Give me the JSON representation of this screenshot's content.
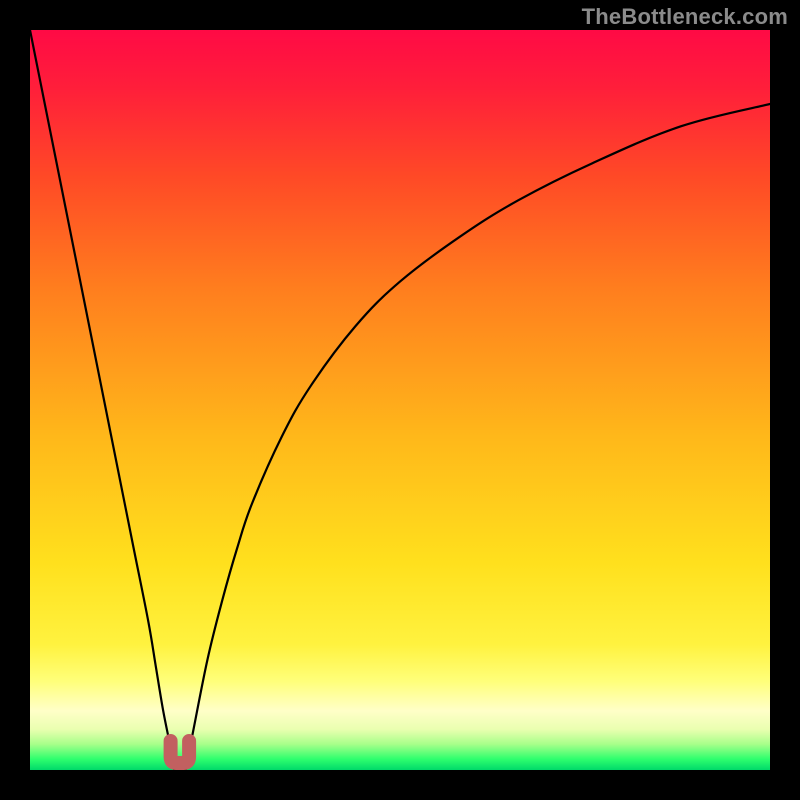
{
  "watermark": "TheBottleneck.com",
  "colors": {
    "frame": "#000000",
    "gradient_stops": [
      {
        "offset": 0.0,
        "color": "#ff0a45"
      },
      {
        "offset": 0.08,
        "color": "#ff1f3a"
      },
      {
        "offset": 0.2,
        "color": "#ff4a26"
      },
      {
        "offset": 0.35,
        "color": "#ff7e1e"
      },
      {
        "offset": 0.55,
        "color": "#ffb81a"
      },
      {
        "offset": 0.72,
        "color": "#ffe01d"
      },
      {
        "offset": 0.83,
        "color": "#fff23f"
      },
      {
        "offset": 0.88,
        "color": "#ffff7a"
      },
      {
        "offset": 0.92,
        "color": "#ffffc8"
      },
      {
        "offset": 0.945,
        "color": "#eaffb0"
      },
      {
        "offset": 0.965,
        "color": "#a8ff8a"
      },
      {
        "offset": 0.985,
        "color": "#2fff6e"
      },
      {
        "offset": 1.0,
        "color": "#00d96a"
      }
    ],
    "curve_stroke": "#000000",
    "marker_fill": "#c26060",
    "marker_stroke": "#c26060"
  },
  "chart_data": {
    "type": "line",
    "title": "",
    "xlabel": "",
    "ylabel": "",
    "xlim": [
      0,
      100
    ],
    "ylim": [
      0,
      100
    ],
    "grid": false,
    "legend": false,
    "annotations": [],
    "series": [
      {
        "name": "left-branch",
        "comment": "Bottleneck percentage vs component balance; left falling branch sampled at x positions 0..~19.5, values estimated from pixel heights",
        "x": [
          0,
          2,
          4,
          6,
          8,
          10,
          12,
          14,
          16,
          17,
          18,
          19,
          19.5
        ],
        "values": [
          100,
          90,
          80,
          70,
          60,
          50,
          40,
          30,
          20,
          14,
          8,
          3,
          0
        ]
      },
      {
        "name": "right-branch",
        "comment": "Right rising branch sampled x ~21..100",
        "x": [
          21,
          22,
          24,
          26,
          28,
          30,
          34,
          38,
          44,
          50,
          58,
          66,
          76,
          88,
          100
        ],
        "values": [
          0,
          5,
          15,
          23,
          30,
          36,
          45,
          52,
          60,
          66,
          72,
          77,
          82,
          87,
          90
        ]
      }
    ],
    "marker": {
      "name": "optimal-point",
      "comment": "U-shaped marker near x≈20, y≈0 indicating minimum bottleneck",
      "x_range": [
        19,
        21.5
      ],
      "y": 0
    }
  }
}
